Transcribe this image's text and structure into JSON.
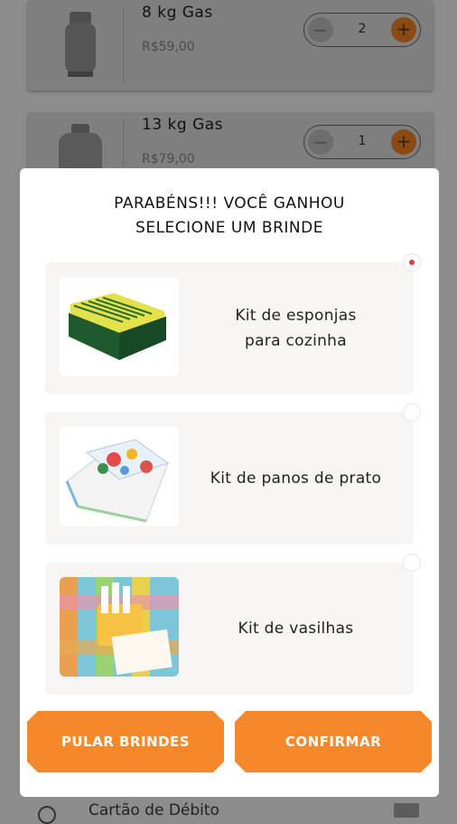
{
  "products": [
    {
      "name": "8 kg Gas",
      "price": "R$59,00",
      "quantity": "2"
    },
    {
      "name": "13 kg Gas",
      "price": "R$79,00",
      "quantity": "1"
    }
  ],
  "stepper": {
    "minus": "−",
    "plus": "+"
  },
  "footer": {
    "payment_label": "Cartão de Débito"
  },
  "modal": {
    "title_line1": "PARABÉNS!!! VOCÊ GANHOU",
    "title_line2": "SELECIONE UM BRINDE",
    "gifts": [
      {
        "label_line1": "Kit de esponjas",
        "label_line2": "para cozinha",
        "selected": true
      },
      {
        "label_line1": "Kit de panos de prato",
        "label_line2": "",
        "selected": false
      },
      {
        "label_line1": "Kit de vasilhas",
        "label_line2": "",
        "selected": false
      }
    ],
    "skip_button": "PULAR BRINDES",
    "confirm_button": "CONFIRMAR"
  },
  "colors": {
    "accent": "#f5882b",
    "overlay": "#8c8c8c",
    "selected_dot": "#e63b3b"
  }
}
